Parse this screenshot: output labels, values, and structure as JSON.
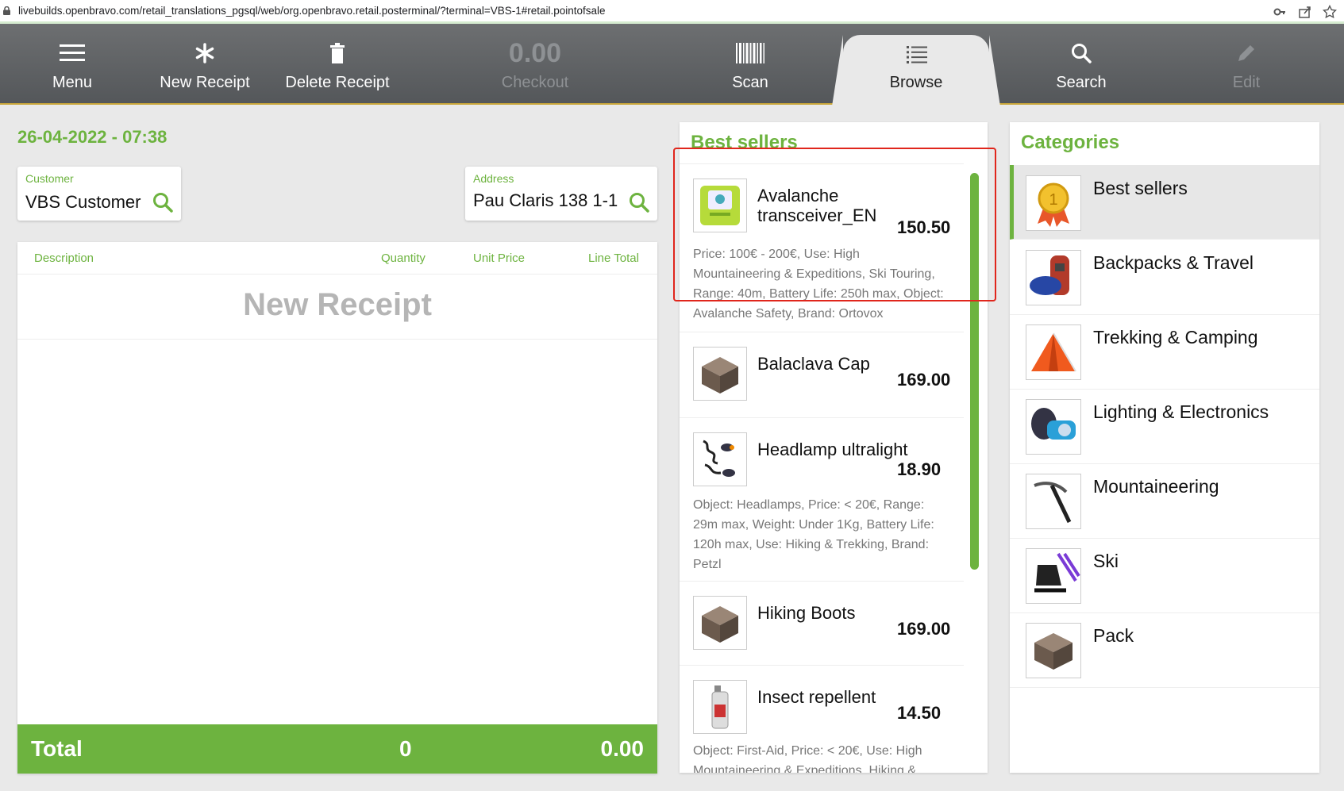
{
  "browser": {
    "url": "livebuilds.openbravo.com/retail_translations_pgsql/web/org.openbravo.retail.posterminal/?terminal=VBS-1#retail.pointofsale"
  },
  "toolbar": {
    "menu_label": "Menu",
    "new_receipt_label": "New Receipt",
    "delete_receipt_label": "Delete Receipt",
    "checkout_amount": "0.00",
    "checkout_label": "Checkout",
    "scan_label": "Scan",
    "browse_label": "Browse",
    "search_label": "Search",
    "edit_label": "Edit"
  },
  "receipt": {
    "datetime": "26-04-2022 - 07:38",
    "customer_label": "Customer",
    "customer_value": "VBS Customer",
    "address_label": "Address",
    "address_value": "Pau Claris 138 1-1",
    "col_description": "Description",
    "col_quantity": "Quantity",
    "col_unit_price": "Unit Price",
    "col_line_total": "Line Total",
    "placeholder": "New Receipt",
    "total_label": "Total",
    "total_qty": "0",
    "total_amount": "0.00"
  },
  "best_sellers": {
    "title": "Best sellers",
    "products": [
      {
        "name_line1": "Avalanche",
        "name_line2": "transceiver_EN",
        "price": "150.50",
        "desc": [
          "Price: 100€ - 200€, Use: High",
          "Mountaineering & Expeditions, Ski Touring,",
          "Range: 40m, Battery Life: 250h max, Object:",
          "Avalanche Safety, Brand: Ortovox"
        ]
      },
      {
        "name_line1": "Balaclava Cap",
        "name_line2": "",
        "price": "169.00",
        "desc": []
      },
      {
        "name_line1": "Headlamp ultralight",
        "name_line2": "",
        "price": "18.90",
        "desc": [
          "Object: Headlamps, Price: < 20€, Range:",
          "29m max, Weight: Under 1Kg, Battery Life:",
          "120h max, Use: Hiking & Trekking, Brand:",
          "Petzl"
        ]
      },
      {
        "name_line1": "Hiking Boots",
        "name_line2": "",
        "price": "169.00",
        "desc": []
      },
      {
        "name_line1": "Insect repellent",
        "name_line2": "",
        "price": "14.50",
        "desc": [
          "Object: First-Aid, Price: < 20€, Use: High",
          "Mountaineering & Expeditions, Hiking &"
        ]
      }
    ]
  },
  "categories": {
    "title": "Categories",
    "items": [
      "Best sellers",
      "Backpacks & Travel",
      "Trekking & Camping",
      "Lighting & Electronics",
      "Mountaineering",
      "Ski",
      "Pack"
    ]
  },
  "colors": {
    "accent": "#6db33f",
    "toolbar": "#5f6265",
    "highlight": "#e0261c"
  }
}
